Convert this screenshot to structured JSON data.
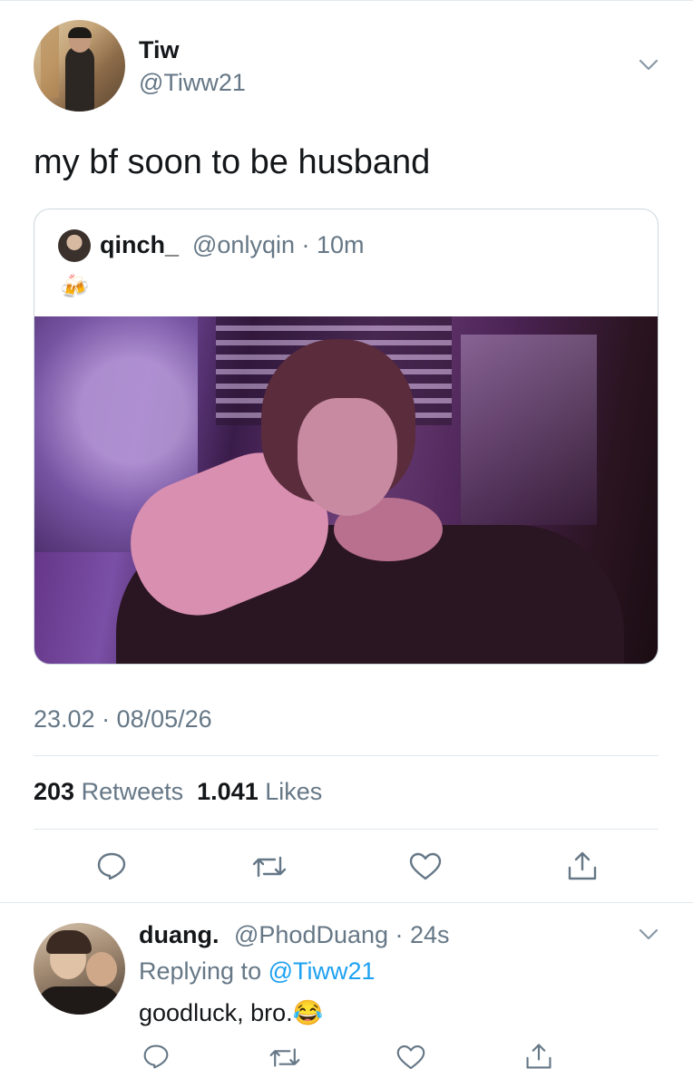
{
  "tweet": {
    "author_name": "Tiw",
    "author_handle": "@Tiww21",
    "text": "my bf soon to be husband",
    "timestamp": "23.02 · 08/05/26",
    "retweets_count": "203",
    "retweets_label": "Retweets",
    "likes_count": "1.041",
    "likes_label": "Likes"
  },
  "quoted": {
    "name": "qinch_",
    "handle_time": "@onlyqin · 10m",
    "emoji": "🍻"
  },
  "reply": {
    "name": "duang.",
    "handle_time": "@PhodDuang · 24s",
    "replying_prefix": "Replying to ",
    "replying_handle": "@Tiww21",
    "text": "goodluck, bro.😂"
  },
  "icons": [
    "chevron-down-icon",
    "reply-icon",
    "retweet-icon",
    "like-icon",
    "share-icon"
  ],
  "colors": {
    "text": "#14171a",
    "secondary": "#657786",
    "link": "#1da1f2",
    "border": "#e1e8ed"
  }
}
